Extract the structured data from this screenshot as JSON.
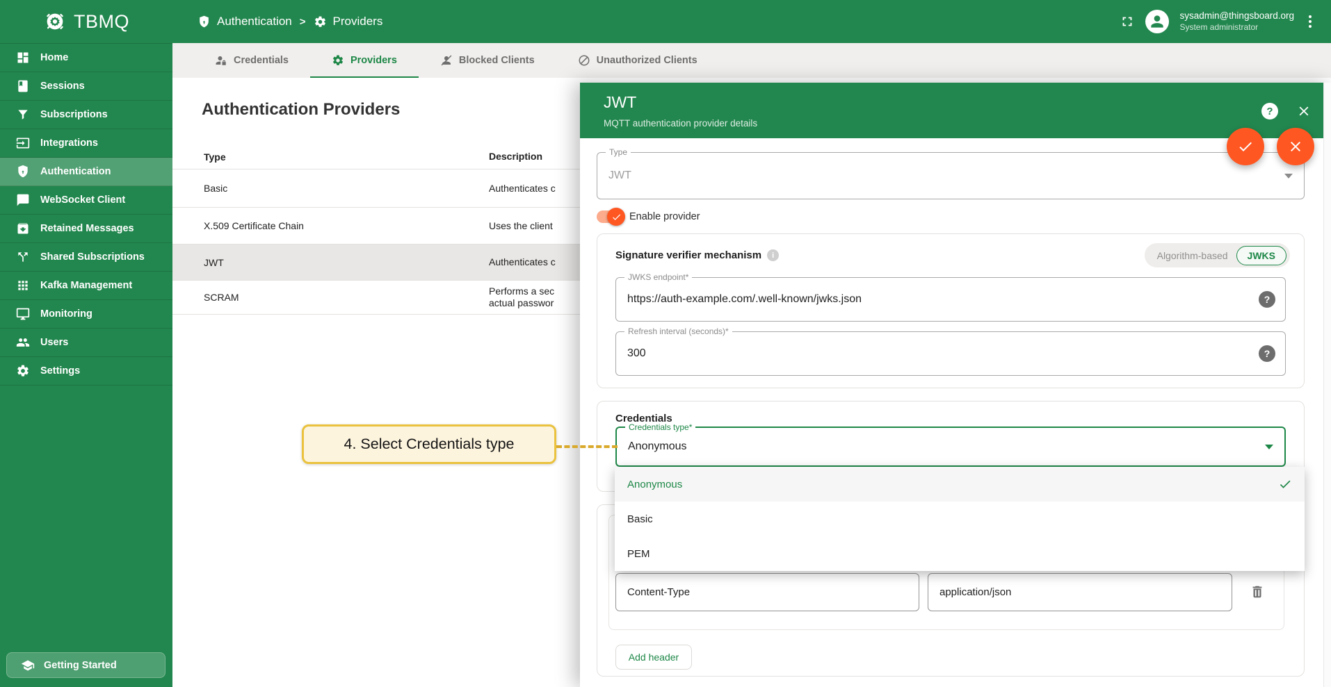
{
  "topbar": {
    "logo_text": "TBMQ",
    "breadcrumb": [
      {
        "icon": "shield-icon",
        "label": "Authentication"
      },
      {
        "icon": "gear-icon",
        "label": "Providers"
      }
    ],
    "separator": ">",
    "user": {
      "email": "sysadmin@thingsboard.org",
      "role": "System administrator"
    }
  },
  "sidebar": {
    "items": [
      {
        "icon": "dashboard-icon",
        "label": "Home",
        "active": false
      },
      {
        "icon": "sessions-icon",
        "label": "Sessions",
        "active": false
      },
      {
        "icon": "filter-icon",
        "label": "Subscriptions",
        "active": false
      },
      {
        "icon": "input-icon",
        "label": "Integrations",
        "active": false
      },
      {
        "icon": "shield-icon",
        "label": "Authentication",
        "active": true
      },
      {
        "icon": "chat-icon",
        "label": "WebSocket Client",
        "active": false
      },
      {
        "icon": "archive-icon",
        "label": "Retained Messages",
        "active": false
      },
      {
        "icon": "split-icon",
        "label": "Shared Subscriptions",
        "active": false
      },
      {
        "icon": "apps-grid-icon",
        "label": "Kafka Management",
        "active": false
      },
      {
        "icon": "monitor-icon",
        "label": "Monitoring",
        "active": false
      },
      {
        "icon": "people-icon",
        "label": "Users",
        "active": false
      },
      {
        "icon": "gear-icon",
        "label": "Settings",
        "active": false
      }
    ],
    "getting_started": "Getting Started"
  },
  "tabs": [
    {
      "icon": "person-lock-icon",
      "label": "Credentials",
      "active": false
    },
    {
      "icon": "gear-icon",
      "label": "Providers",
      "active": true
    },
    {
      "icon": "person-block-icon",
      "label": "Blocked Clients",
      "active": false
    },
    {
      "icon": "block-icon",
      "label": "Unauthorized Clients",
      "active": false
    }
  ],
  "main": {
    "title": "Authentication Providers",
    "table": {
      "columns": [
        "Type",
        "Description"
      ],
      "rows": [
        {
          "type": "Basic",
          "desc": "Authenticates c",
          "desc2": "",
          "selected": false
        },
        {
          "type": "X.509 Certificate Chain",
          "desc": "Uses the client",
          "desc2": "",
          "selected": false
        },
        {
          "type": "JWT",
          "desc": "Authenticates c",
          "desc2": "",
          "selected": true
        },
        {
          "type": "SCRAM",
          "desc": "Performs a sec",
          "desc2": "actual passwor",
          "selected": false
        }
      ]
    }
  },
  "drawer": {
    "title": "JWT",
    "subtitle": "MQTT authentication provider details",
    "help_icon": "?",
    "type_field": {
      "label": "Type",
      "value": "JWT",
      "disabled": true
    },
    "enable_label": "Enable provider",
    "enable_checked": true,
    "signature": {
      "title": "Signature verifier mechanism",
      "info_icon": "i",
      "options": [
        {
          "label": "Algorithm-based",
          "selected": false
        },
        {
          "label": "JWKS",
          "selected": true
        }
      ],
      "jwks_endpoint": {
        "label": "JWKS endpoint*",
        "value": "https://auth-example.com/.well-known/jwks.json"
      },
      "refresh_interval": {
        "label": "Refresh interval (seconds)*",
        "value": "300"
      }
    },
    "credentials": {
      "title": "Credentials",
      "field": {
        "label": "Credentials type*",
        "value": "Anonymous"
      },
      "options": [
        {
          "label": "Anonymous",
          "checked": true
        },
        {
          "label": "Basic",
          "checked": false
        },
        {
          "label": "PEM",
          "checked": false
        }
      ]
    },
    "headers": {
      "rows": [
        {
          "key": "Content-Type",
          "value": "application/json"
        }
      ],
      "add_label": "Add header"
    }
  },
  "annotation": {
    "text": "4. Select Credentials type"
  },
  "colors": {
    "brand_green": "#22874e",
    "accent_green": "#1d8747",
    "accent_orange": "#ff5722",
    "annotation_gold": "#eac23e",
    "selected_row": "#e9e7e5"
  }
}
